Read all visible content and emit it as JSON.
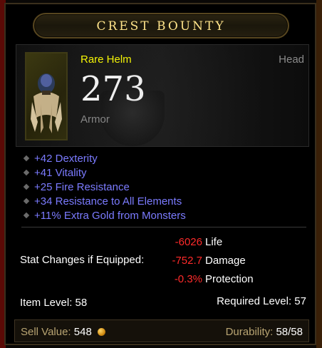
{
  "title": "CREST BOUNTY",
  "item": {
    "type": "Rare Helm",
    "slot": "Head",
    "armor_value": "273",
    "armor_label": "Armor"
  },
  "affixes": [
    "+42 Dexterity",
    "+41 Vitality",
    "+25 Fire Resistance",
    "+34 Resistance to All Elements",
    "+11% Extra Gold from Monsters"
  ],
  "stat_changes": {
    "label": "Stat Changes if Equipped:",
    "rows": [
      {
        "value": "-6026",
        "name": "Life"
      },
      {
        "value": "-752.7",
        "name": "Damage"
      },
      {
        "value": "-0.3%",
        "name": "Protection"
      }
    ]
  },
  "item_level": "Item Level: 58",
  "required_level": "Required Level: 57",
  "footer": {
    "sell_label": "Sell Value:",
    "sell_value": "548",
    "durability_label": "Durability:",
    "durability_value": "58/58"
  },
  "colors": {
    "title": "#ffe48a",
    "rare": "#ffff00",
    "affix": "#7b7bff",
    "negative": "#ff2a2a"
  }
}
